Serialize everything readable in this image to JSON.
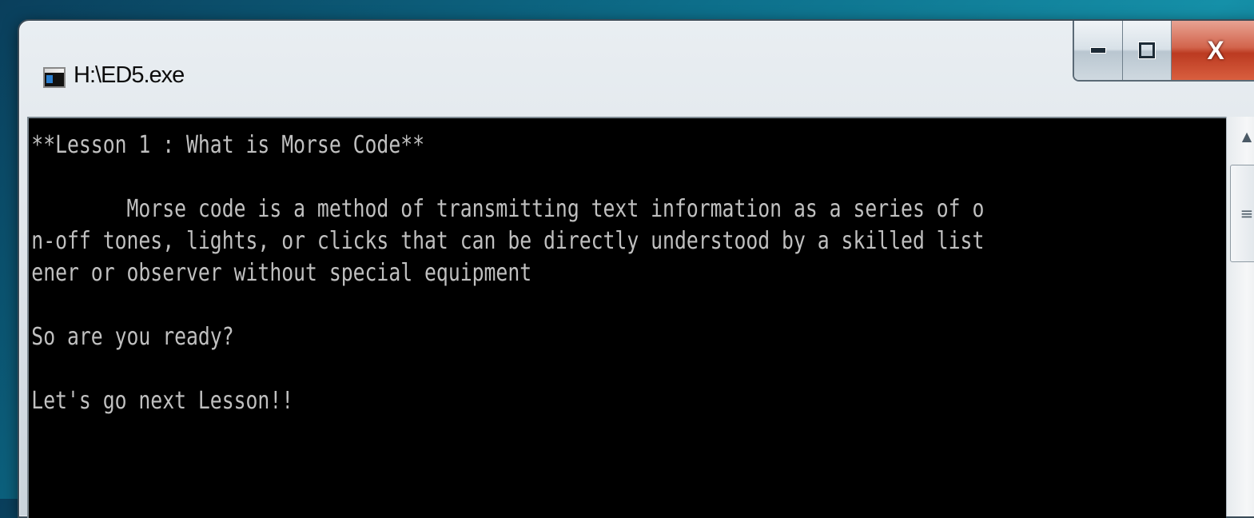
{
  "window": {
    "title": "H:\\ED5.exe",
    "icon": "console-app-icon"
  },
  "caption_buttons": {
    "close_label": "X"
  },
  "console": {
    "lines": [
      "**Lesson 1 : What is Morse Code**",
      "",
      "        Morse code is a method of transmitting text information as a series of o",
      "n-off tones, lights, or clicks that can be directly understood by a skilled list",
      "ener or observer without special equipment",
      "",
      "So are you ready?",
      "",
      "Let's go next Lesson!!"
    ],
    "text_color": "#c0c0c0",
    "background_color": "#000000"
  },
  "scrollbar": {
    "up_arrow": "▲",
    "thumb_grip": "≡"
  }
}
